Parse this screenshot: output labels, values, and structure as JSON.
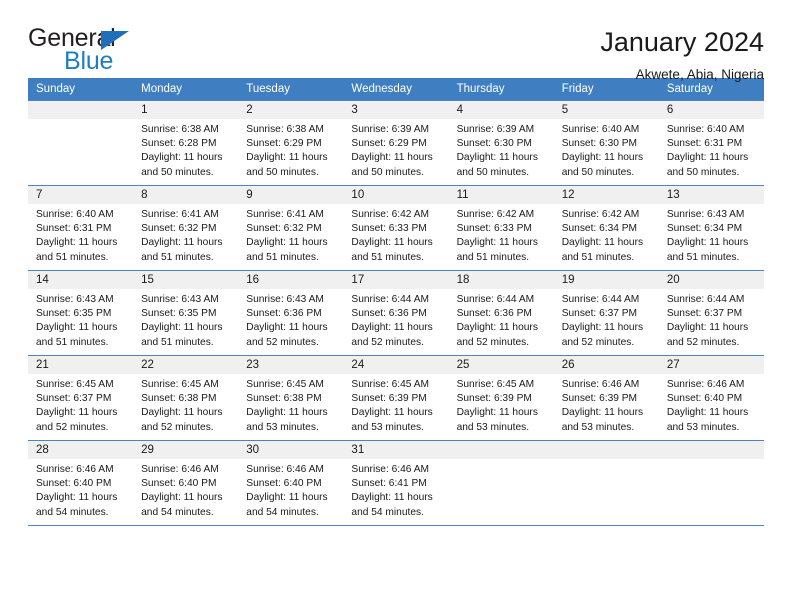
{
  "brand": {
    "name_top": "General",
    "name_bottom": "Blue",
    "accent_color": "#1f7dc4",
    "flag_icon": "triangle-flag-icon"
  },
  "header": {
    "title": "January 2024",
    "subtitle": "Akwete, Abia, Nigeria"
  },
  "calendar": {
    "header_bg": "#3f7fc1",
    "daynum_bg": "#f0f0f0",
    "grid_line_color": "#4a84c4",
    "weekday_headers": [
      "Sunday",
      "Monday",
      "Tuesday",
      "Wednesday",
      "Thursday",
      "Friday",
      "Saturday"
    ],
    "weeks": [
      [
        {
          "day": "",
          "sunrise": "",
          "sunset": "",
          "daylight_line1": "",
          "daylight_line2": "",
          "empty": true
        },
        {
          "day": "1",
          "sunrise": "Sunrise: 6:38 AM",
          "sunset": "Sunset: 6:28 PM",
          "daylight_line1": "Daylight: 11 hours",
          "daylight_line2": "and 50 minutes.",
          "empty": false
        },
        {
          "day": "2",
          "sunrise": "Sunrise: 6:38 AM",
          "sunset": "Sunset: 6:29 PM",
          "daylight_line1": "Daylight: 11 hours",
          "daylight_line2": "and 50 minutes.",
          "empty": false
        },
        {
          "day": "3",
          "sunrise": "Sunrise: 6:39 AM",
          "sunset": "Sunset: 6:29 PM",
          "daylight_line1": "Daylight: 11 hours",
          "daylight_line2": "and 50 minutes.",
          "empty": false
        },
        {
          "day": "4",
          "sunrise": "Sunrise: 6:39 AM",
          "sunset": "Sunset: 6:30 PM",
          "daylight_line1": "Daylight: 11 hours",
          "daylight_line2": "and 50 minutes.",
          "empty": false
        },
        {
          "day": "5",
          "sunrise": "Sunrise: 6:40 AM",
          "sunset": "Sunset: 6:30 PM",
          "daylight_line1": "Daylight: 11 hours",
          "daylight_line2": "and 50 minutes.",
          "empty": false
        },
        {
          "day": "6",
          "sunrise": "Sunrise: 6:40 AM",
          "sunset": "Sunset: 6:31 PM",
          "daylight_line1": "Daylight: 11 hours",
          "daylight_line2": "and 50 minutes.",
          "empty": false
        }
      ],
      [
        {
          "day": "7",
          "sunrise": "Sunrise: 6:40 AM",
          "sunset": "Sunset: 6:31 PM",
          "daylight_line1": "Daylight: 11 hours",
          "daylight_line2": "and 51 minutes.",
          "empty": false
        },
        {
          "day": "8",
          "sunrise": "Sunrise: 6:41 AM",
          "sunset": "Sunset: 6:32 PM",
          "daylight_line1": "Daylight: 11 hours",
          "daylight_line2": "and 51 minutes.",
          "empty": false
        },
        {
          "day": "9",
          "sunrise": "Sunrise: 6:41 AM",
          "sunset": "Sunset: 6:32 PM",
          "daylight_line1": "Daylight: 11 hours",
          "daylight_line2": "and 51 minutes.",
          "empty": false
        },
        {
          "day": "10",
          "sunrise": "Sunrise: 6:42 AM",
          "sunset": "Sunset: 6:33 PM",
          "daylight_line1": "Daylight: 11 hours",
          "daylight_line2": "and 51 minutes.",
          "empty": false
        },
        {
          "day": "11",
          "sunrise": "Sunrise: 6:42 AM",
          "sunset": "Sunset: 6:33 PM",
          "daylight_line1": "Daylight: 11 hours",
          "daylight_line2": "and 51 minutes.",
          "empty": false
        },
        {
          "day": "12",
          "sunrise": "Sunrise: 6:42 AM",
          "sunset": "Sunset: 6:34 PM",
          "daylight_line1": "Daylight: 11 hours",
          "daylight_line2": "and 51 minutes.",
          "empty": false
        },
        {
          "day": "13",
          "sunrise": "Sunrise: 6:43 AM",
          "sunset": "Sunset: 6:34 PM",
          "daylight_line1": "Daylight: 11 hours",
          "daylight_line2": "and 51 minutes.",
          "empty": false
        }
      ],
      [
        {
          "day": "14",
          "sunrise": "Sunrise: 6:43 AM",
          "sunset": "Sunset: 6:35 PM",
          "daylight_line1": "Daylight: 11 hours",
          "daylight_line2": "and 51 minutes.",
          "empty": false
        },
        {
          "day": "15",
          "sunrise": "Sunrise: 6:43 AM",
          "sunset": "Sunset: 6:35 PM",
          "daylight_line1": "Daylight: 11 hours",
          "daylight_line2": "and 51 minutes.",
          "empty": false
        },
        {
          "day": "16",
          "sunrise": "Sunrise: 6:43 AM",
          "sunset": "Sunset: 6:36 PM",
          "daylight_line1": "Daylight: 11 hours",
          "daylight_line2": "and 52 minutes.",
          "empty": false
        },
        {
          "day": "17",
          "sunrise": "Sunrise: 6:44 AM",
          "sunset": "Sunset: 6:36 PM",
          "daylight_line1": "Daylight: 11 hours",
          "daylight_line2": "and 52 minutes.",
          "empty": false
        },
        {
          "day": "18",
          "sunrise": "Sunrise: 6:44 AM",
          "sunset": "Sunset: 6:36 PM",
          "daylight_line1": "Daylight: 11 hours",
          "daylight_line2": "and 52 minutes.",
          "empty": false
        },
        {
          "day": "19",
          "sunrise": "Sunrise: 6:44 AM",
          "sunset": "Sunset: 6:37 PM",
          "daylight_line1": "Daylight: 11 hours",
          "daylight_line2": "and 52 minutes.",
          "empty": false
        },
        {
          "day": "20",
          "sunrise": "Sunrise: 6:44 AM",
          "sunset": "Sunset: 6:37 PM",
          "daylight_line1": "Daylight: 11 hours",
          "daylight_line2": "and 52 minutes.",
          "empty": false
        }
      ],
      [
        {
          "day": "21",
          "sunrise": "Sunrise: 6:45 AM",
          "sunset": "Sunset: 6:37 PM",
          "daylight_line1": "Daylight: 11 hours",
          "daylight_line2": "and 52 minutes.",
          "empty": false
        },
        {
          "day": "22",
          "sunrise": "Sunrise: 6:45 AM",
          "sunset": "Sunset: 6:38 PM",
          "daylight_line1": "Daylight: 11 hours",
          "daylight_line2": "and 52 minutes.",
          "empty": false
        },
        {
          "day": "23",
          "sunrise": "Sunrise: 6:45 AM",
          "sunset": "Sunset: 6:38 PM",
          "daylight_line1": "Daylight: 11 hours",
          "daylight_line2": "and 53 minutes.",
          "empty": false
        },
        {
          "day": "24",
          "sunrise": "Sunrise: 6:45 AM",
          "sunset": "Sunset: 6:39 PM",
          "daylight_line1": "Daylight: 11 hours",
          "daylight_line2": "and 53 minutes.",
          "empty": false
        },
        {
          "day": "25",
          "sunrise": "Sunrise: 6:45 AM",
          "sunset": "Sunset: 6:39 PM",
          "daylight_line1": "Daylight: 11 hours",
          "daylight_line2": "and 53 minutes.",
          "empty": false
        },
        {
          "day": "26",
          "sunrise": "Sunrise: 6:46 AM",
          "sunset": "Sunset: 6:39 PM",
          "daylight_line1": "Daylight: 11 hours",
          "daylight_line2": "and 53 minutes.",
          "empty": false
        },
        {
          "day": "27",
          "sunrise": "Sunrise: 6:46 AM",
          "sunset": "Sunset: 6:40 PM",
          "daylight_line1": "Daylight: 11 hours",
          "daylight_line2": "and 53 minutes.",
          "empty": false
        }
      ],
      [
        {
          "day": "28",
          "sunrise": "Sunrise: 6:46 AM",
          "sunset": "Sunset: 6:40 PM",
          "daylight_line1": "Daylight: 11 hours",
          "daylight_line2": "and 54 minutes.",
          "empty": false
        },
        {
          "day": "29",
          "sunrise": "Sunrise: 6:46 AM",
          "sunset": "Sunset: 6:40 PM",
          "daylight_line1": "Daylight: 11 hours",
          "daylight_line2": "and 54 minutes.",
          "empty": false
        },
        {
          "day": "30",
          "sunrise": "Sunrise: 6:46 AM",
          "sunset": "Sunset: 6:40 PM",
          "daylight_line1": "Daylight: 11 hours",
          "daylight_line2": "and 54 minutes.",
          "empty": false
        },
        {
          "day": "31",
          "sunrise": "Sunrise: 6:46 AM",
          "sunset": "Sunset: 6:41 PM",
          "daylight_line1": "Daylight: 11 hours",
          "daylight_line2": "and 54 minutes.",
          "empty": false
        },
        {
          "day": "",
          "sunrise": "",
          "sunset": "",
          "daylight_line1": "",
          "daylight_line2": "",
          "empty": true
        },
        {
          "day": "",
          "sunrise": "",
          "sunset": "",
          "daylight_line1": "",
          "daylight_line2": "",
          "empty": true
        },
        {
          "day": "",
          "sunrise": "",
          "sunset": "",
          "daylight_line1": "",
          "daylight_line2": "",
          "empty": true
        }
      ]
    ]
  }
}
